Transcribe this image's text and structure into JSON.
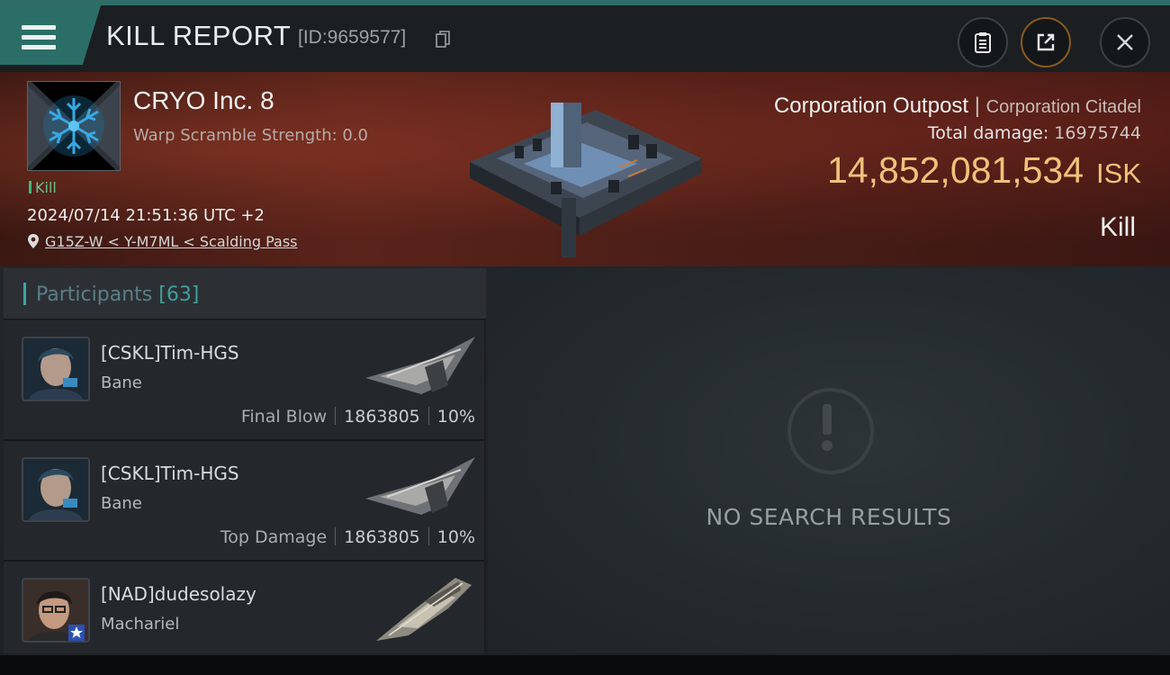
{
  "header": {
    "title": "KILL REPORT",
    "report_id": "[ID:9659577]"
  },
  "victim": {
    "corp_name": "CRYO Inc. 8",
    "warp_scramble": "Warp Scramble Strength: 0.0",
    "kill_tag": "Kill",
    "datetime": "2024/07/14 21:51:36 UTC +2",
    "location": "G15Z-W < Y-M7ML < Scalding Pass",
    "structure_type": "Corporation Outpost",
    "structure_class": "Corporation Citadel",
    "total_damage_label": "Total damage:",
    "total_damage_value": "16975744",
    "isk_value": "14,852,081,534",
    "isk_unit": "ISK",
    "result": "Kill"
  },
  "participants": {
    "label": "Participants",
    "count": "[63]",
    "items": [
      {
        "name": "[CSKL]Tim-HGS",
        "ship": "Bane",
        "role": "Final Blow",
        "damage": "1863805",
        "percent": "10%"
      },
      {
        "name": "[CSKL]Tim-HGS",
        "ship": "Bane",
        "role": "Top Damage",
        "damage": "1863805",
        "percent": "10%"
      },
      {
        "name": "[NAD]dudesolazy",
        "ship": "Machariel",
        "role": "",
        "damage": "",
        "percent": ""
      }
    ]
  },
  "results": {
    "empty_message": "NO SEARCH RESULTS"
  },
  "colors": {
    "accent": "#2b6e67",
    "isk": "#f1c27a",
    "kill": "#3fb879"
  }
}
